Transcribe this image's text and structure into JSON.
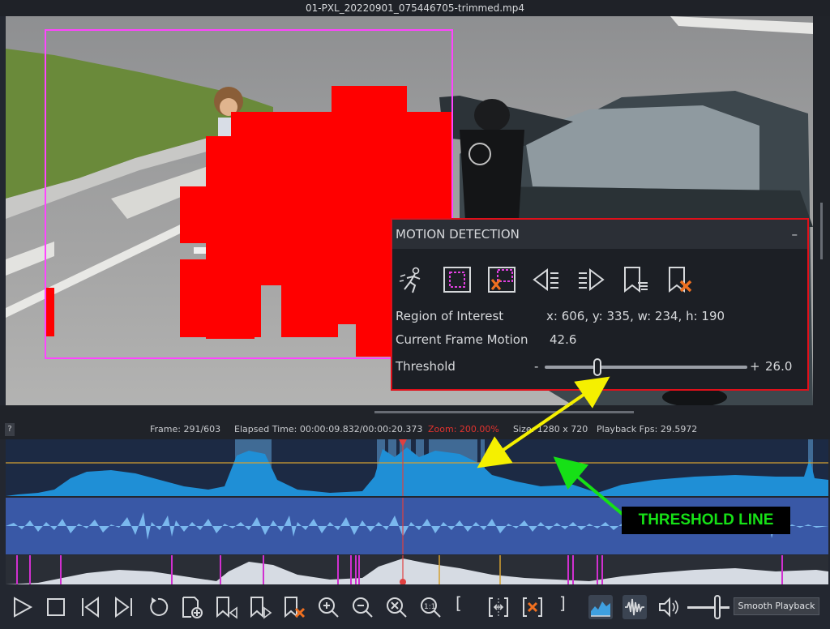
{
  "window": {
    "title": "01-PXL_20220901_075446705-trimmed.mp4"
  },
  "status": {
    "help": "?",
    "frame": "Frame: 291/603",
    "elapsed": "Elapsed Time: 00:00:09.832/00:00:20.373",
    "zoom": "Zoom: 200.00%",
    "size": "Size: 1280 x 720",
    "fps": "Playback Fps: 29.5972"
  },
  "motion_panel": {
    "title": "MOTION DETECTION",
    "minimize": "–",
    "roi_label": "Region of Interest",
    "roi_value": "x: 606,  y: 335,  w: 234,  h: 190",
    "motion_label": "Current Frame Motion",
    "motion_value": "42.6",
    "threshold_label": "Threshold",
    "threshold_minus": "-",
    "threshold_plus": "+",
    "threshold_value": "26.0",
    "icons": [
      "motion-runner-icon",
      "roi-select-icon",
      "roi-clear-icon",
      "prev-motion-icon",
      "next-motion-icon",
      "bookmark-list-icon",
      "bookmark-clear-icon"
    ]
  },
  "annotation": {
    "callout": "THRESHOLD LINE"
  },
  "toolbar": {
    "smooth_playback": "Smooth Playback",
    "bracket_in": "[",
    "bracket_out": "]",
    "icons": [
      "play-icon",
      "stop-icon",
      "skip-start-icon",
      "skip-end-icon",
      "replay-icon",
      "add-frame-icon",
      "prev-bookmark-icon",
      "next-bookmark-icon",
      "delete-bookmark-icon",
      "zoom-in-icon",
      "zoom-out-icon",
      "zoom-reset-icon",
      "zoom-1to1-icon",
      "trim-select-icon",
      "trim-delete-icon",
      "motion-graph-icon",
      "audio-wave-icon",
      "volume-icon"
    ]
  },
  "colors": {
    "accent": "#3fa0e0",
    "motion_fill": "#ff0000",
    "roi": "#ff44ff",
    "threshold": "#d4a030",
    "callout_text": "#16e016"
  }
}
